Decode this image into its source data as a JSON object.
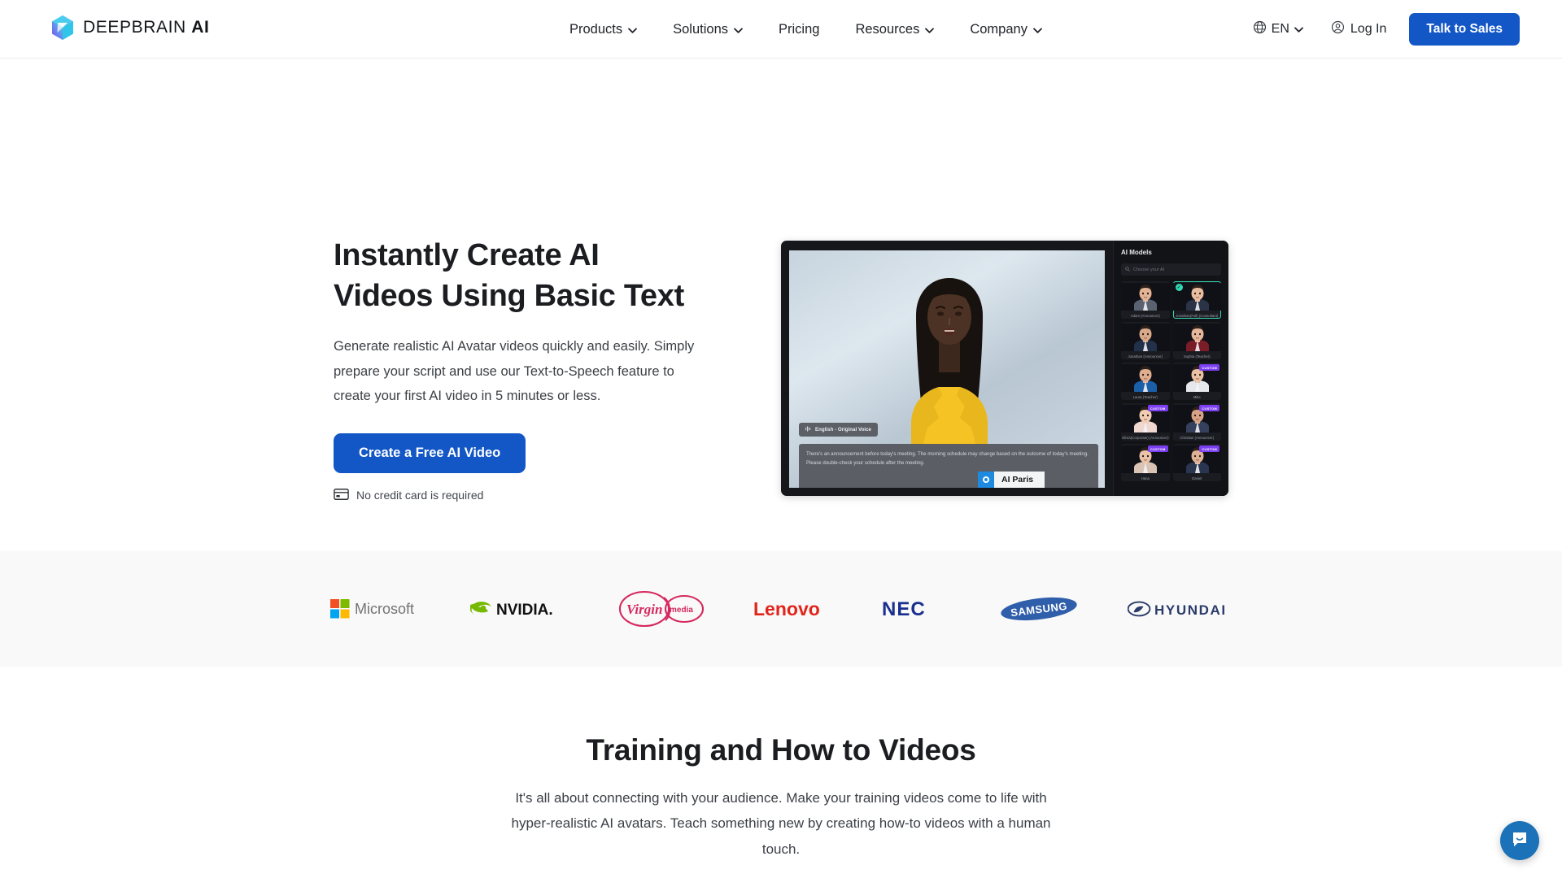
{
  "header": {
    "brand": {
      "name_light": "DEEPBRAIN",
      "name_bold": "AI"
    },
    "nav": [
      {
        "label": "Products",
        "has_caret": true
      },
      {
        "label": "Solutions",
        "has_caret": true
      },
      {
        "label": "Pricing",
        "has_caret": false
      },
      {
        "label": "Resources",
        "has_caret": true
      },
      {
        "label": "Company",
        "has_caret": true
      }
    ],
    "language": "EN",
    "login_label": "Log In",
    "cta_label": "Talk to Sales",
    "cta_color": "#1357c6"
  },
  "hero": {
    "title_line1": "Instantly Create AI",
    "title_line2": "Videos Using Basic Text",
    "subtitle": "Generate realistic AI Avatar videos quickly and easily. Simply prepare your script and use our Text-to-Speech feature to create your first AI video in 5 minutes or less.",
    "cta_label": "Create a Free AI Video",
    "note": "No credit card is required",
    "cta_color": "#1357c6"
  },
  "preview": {
    "voice_label": "English - Original Voice",
    "script_text": "There's an announcement before today's meeting. The morning schedule may change based on the outcome of today's meeting. Please double-check your schedule after the meeting.",
    "avatar_name": "AI Paris",
    "panel_title": "AI Models",
    "search_placeholder": "Choose your AI",
    "models": [
      {
        "label": "Adam (Announcer)",
        "selected": false,
        "custom": false
      },
      {
        "label": "Jonathan(Full) (Consultant)",
        "selected": true,
        "custom": false
      },
      {
        "label": "Jonathan (Announcer)",
        "selected": false,
        "custom": false
      },
      {
        "label": "Sophia (Teacher)",
        "selected": false,
        "custom": false
      },
      {
        "label": "Laura (Teacher)",
        "selected": false,
        "custom": false
      },
      {
        "label": "Mike",
        "selected": false,
        "custom": true
      },
      {
        "label": "Olivia(Corporate) (Announcer)",
        "selected": false,
        "custom": true
      },
      {
        "label": "Christian (Announcer)",
        "selected": false,
        "custom": true
      },
      {
        "label": "Hana",
        "selected": false,
        "custom": true
      },
      {
        "label": "Daniel",
        "selected": false,
        "custom": true
      }
    ]
  },
  "logos": [
    {
      "name": "Microsoft"
    },
    {
      "name": "NVIDIA"
    },
    {
      "name": "Virgin Media"
    },
    {
      "name": "Lenovo"
    },
    {
      "name": "NEC"
    },
    {
      "name": "SAMSUNG"
    },
    {
      "name": "HYUNDAI"
    }
  ],
  "training": {
    "title": "Training and How to Videos",
    "body": "It's all about connecting with your audience. Make your training videos come to life with hyper-realistic AI avatars. Teach something new by creating how-to videos with a human touch."
  },
  "chat": {
    "label": "Open chat",
    "color": "#1b72b8"
  }
}
